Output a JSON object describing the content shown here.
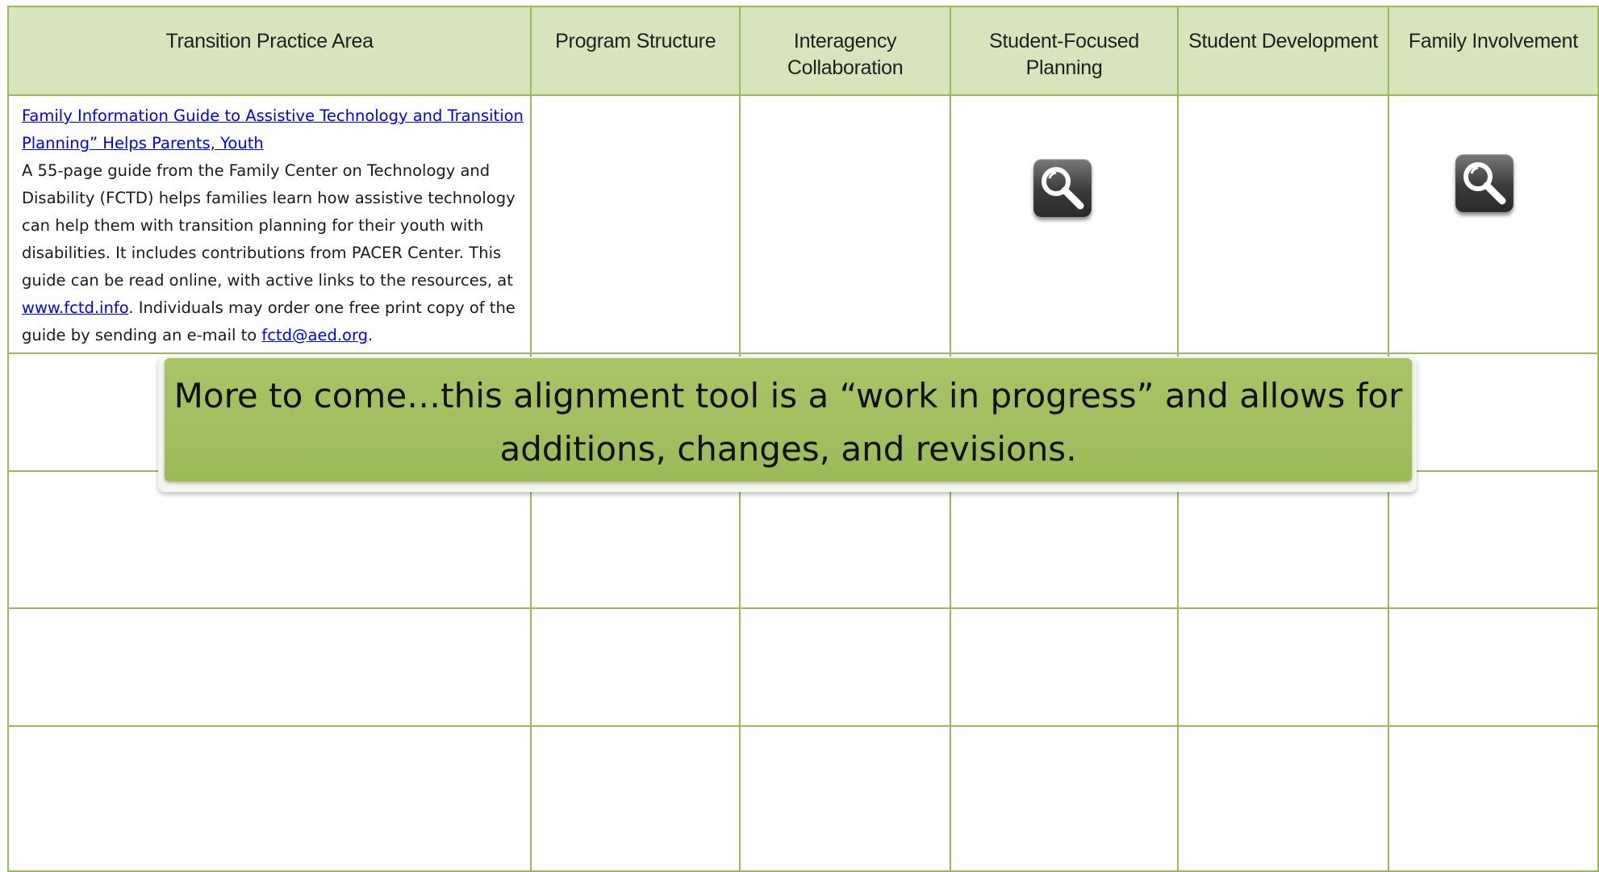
{
  "table": {
    "headers": [
      "Transition Practice Area",
      "Program Structure",
      "Interagency Collaboration",
      "Student-Focused Planning",
      "Student Development",
      "Family Involvement"
    ],
    "header_lines": {
      "interagency_1": "Interagency",
      "interagency_2": "Collaboration",
      "student_focused_1": "Student-Focused",
      "student_focused_2": "Planning"
    },
    "resource": {
      "title_line1": "Family Information Guide to Assistive Technology and Transition",
      "title_line2": "Planning” Helps Parents, Youth",
      "desc_before_link": "A 55-page guide from the Family Center on Technology and Disability (FCTD) helps families learn how assistive technology can help them with transition planning for their youth with disabilities. It includes contributions from PACER Center. This guide can be read online, with active links to the resources, at ",
      "site_link": "www.fctd.info",
      "desc_middle": ".  Individuals may order one free print copy of the guide by sending an e-mail to ",
      "email_link": "fctd@aed.org",
      "desc_end": "."
    },
    "icons": [
      "magnifier-icon",
      "magnifier-icon"
    ],
    "border_color": "#9bbb59",
    "header_bg": "#d7e4bc"
  },
  "banner": {
    "line1": "More to come…this alignment tool is a “work in progress” and allows for",
    "line2": "additions, changes, and revisions.",
    "color": "#9bbb59"
  }
}
